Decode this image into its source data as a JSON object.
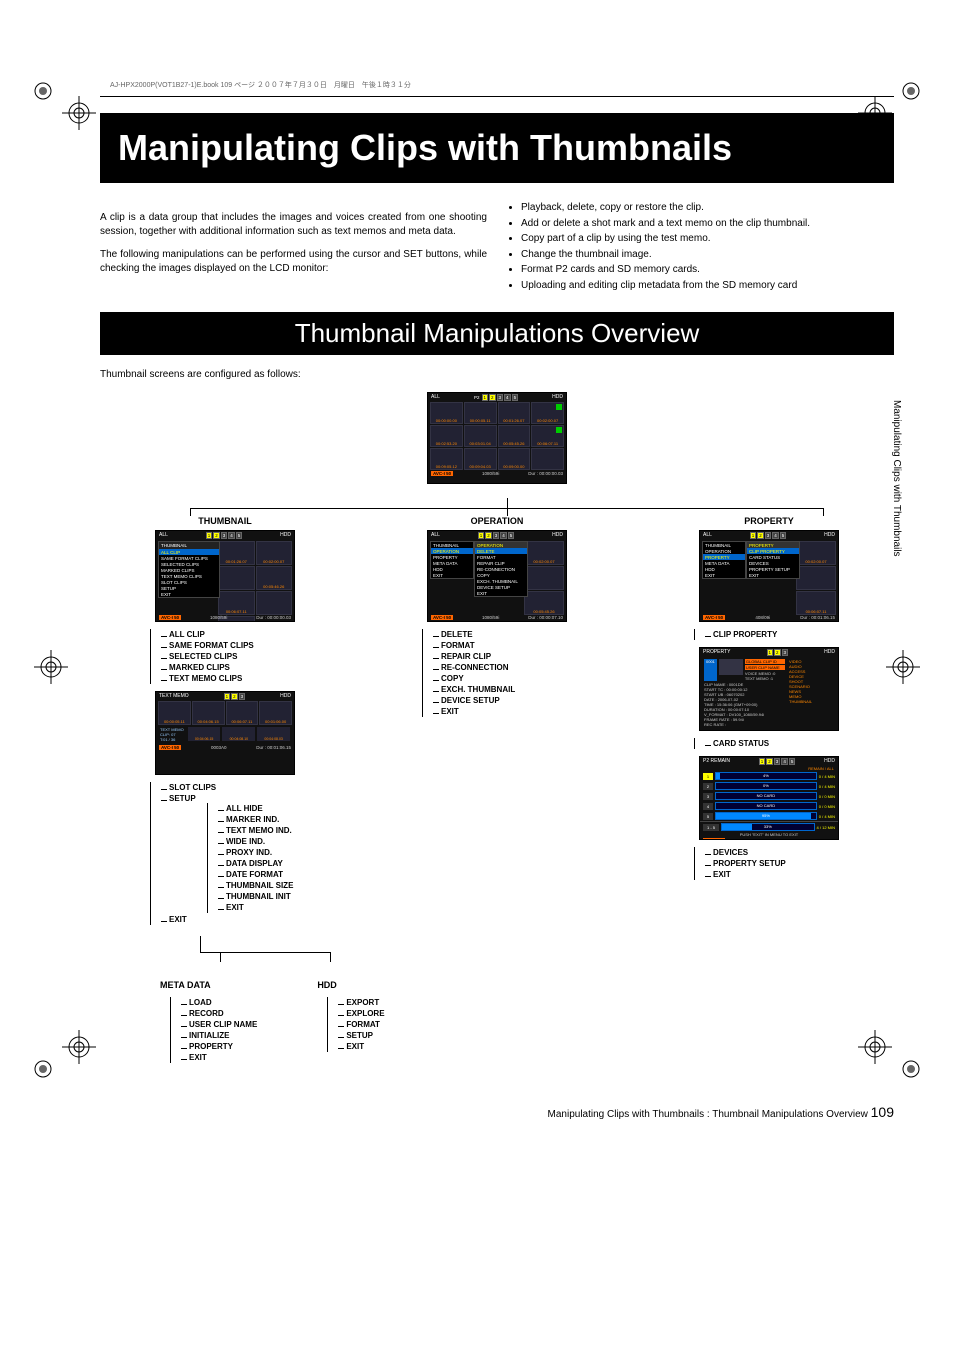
{
  "header_bar": "AJ-HPX2000P(VOT1B27-1)E.book   109 ページ   ２００７年７月３０日　月曜日　午後１時３１分",
  "title": "Manipulating Clips with Thumbnails",
  "intro_col1_p1": "A clip is a data group that includes the images and voices created from one shooting session, together with additional information such as text memos and meta data.",
  "intro_col1_p2": "The following manipulations can be performed using the cursor and SET buttons, while checking the images displayed on the LCD monitor:",
  "intro_col2": [
    "Playback, delete, copy or restore the clip.",
    "Add or delete a shot mark and a text memo on the clip thumbnail.",
    "Copy part of a clip by using the test memo.",
    "Change the thumbnail image.",
    "Format P2 cards and SD memory cards.",
    "Uploading and editing clip metadata from the SD memory card"
  ],
  "subtitle": "Thumbnail Manipulations Overview",
  "subtext": "Thumbnail screens are configured as follows:",
  "top_screen": {
    "all": "ALL",
    "slots": [
      "1",
      "2",
      "3",
      "4",
      "5"
    ],
    "hdd": "HDD",
    "thumbs": [
      "00:00:00.00",
      "00:00:05.11",
      "00:01:26.07",
      "00:02:00.07",
      "00:02:53.20",
      "00:03:01.04",
      "00:05:45.26",
      "00:06:07.11",
      "00:09:05.12",
      "00:09:04.03",
      "00:09:00.00",
      ""
    ],
    "status": {
      "avc": "AVC-I 50",
      "fmt": "1080/59i",
      "dur": "Dur : 00:00:00.03"
    }
  },
  "col_thumbnail": {
    "title": "THUMBNAIL",
    "menu": {
      "header": "THUMBNAIL",
      "items": [
        "ALL CLIP",
        "SAME FORMAT CLIPS",
        "SELECTED CLIPS",
        "MARKED CLIPS",
        "TEXT MEMO CLIPS",
        "SLOT CLIPS",
        "SETUP",
        "EXIT"
      ],
      "right_thumbs": [
        "00:01:26.07",
        "00:02:00.07",
        "",
        "00:05:46.26",
        "00:06:07.11",
        "",
        ""
      ]
    },
    "status": {
      "avc": "AVC-I 50",
      "fmt": "1080/59i",
      "dur": "Dur : 00:00:00.03"
    },
    "tree1": [
      "ALL CLIP",
      "SAME FORMAT CLIPS",
      "SELECTED CLIPS",
      "MARKED CLIPS",
      "TEXT MEMO CLIPS"
    ],
    "textmemo_shot": {
      "title": "TEXT MEMO",
      "thumbs": [
        "",
        "",
        "",
        ""
      ],
      "tc": [
        "00:00:05.11",
        "00:04:06.15",
        "00:06:07.11",
        "00:01:06.00"
      ],
      "lower": "TEXT MEMO\nCLIP: 07\nT:01 / 36",
      "lower_tc": [
        "00:04:06.15",
        "00:04:08.10",
        "00:04:08.03"
      ],
      "status": {
        "avc": "AVC-I 50",
        "fmt": "0003A0",
        "dur": "Dur : 00:01:06.15"
      }
    },
    "tree2_head": [
      "SLOT CLIPS",
      "SETUP",
      "EXIT"
    ],
    "setup_children": [
      "ALL HIDE",
      "MARKER IND.",
      "TEXT MEMO IND.",
      "WIDE IND.",
      "PROXY IND.",
      "DATA DISPLAY",
      "DATE FORMAT",
      "THUMBNAIL SIZE",
      "THUMBNAIL INIT",
      "EXIT"
    ]
  },
  "col_operation": {
    "title": "OPERATION",
    "menu": {
      "left": [
        "THUMBNAIL",
        "OPERATION",
        "PROPERTY",
        "META DATA",
        "HDD",
        "EXIT"
      ],
      "sub_hdr": "OPERATION",
      "sub": [
        "DELETE",
        "FORMAT",
        "REPAIR CLIP",
        "RE-CONNECTION",
        "COPY",
        "EXCH. THUMBNAIL",
        "DEVICE SETUP",
        "EXIT"
      ],
      "right_tc": [
        "00:02:00.07",
        "",
        "00:05:45.26"
      ]
    },
    "status": {
      "avc": "AVC-I 50",
      "fmt": "1080/59i",
      "dur": "Dur : 00:00:07.10"
    },
    "tree": [
      "DELETE",
      "FORMAT",
      "REPAIR CLIP",
      "RE-CONNECTION",
      "COPY",
      "EXCH. THUMBNAIL",
      "DEVICE SETUP",
      "EXIT"
    ]
  },
  "col_property": {
    "title": "PROPERTY",
    "menu": {
      "left": [
        "THUMBNAIL",
        "OPERATION",
        "PROPERTY",
        "META DATA",
        "HDD",
        "EXIT"
      ],
      "sub_hdr": "PROPERTY",
      "sub": [
        "CLIP PROPERTY",
        "CARD STATUS",
        "DEVICES",
        "PROPERTY SETUP",
        "EXIT"
      ],
      "right_tc": [
        "00:02:00.07",
        "",
        "00:06:07.11"
      ]
    },
    "status": {
      "avc": "AVC-I 50",
      "fmt": "408/09i",
      "dur": "Dur : 00:01:06.15"
    },
    "status_thumbs": [
      "00:00:05.11",
      "00:09:04.03",
      "00:09:05.08"
    ],
    "tree1": [
      "CLIP PROPERTY"
    ],
    "clip_prop": {
      "title": "PROPERTY",
      "slot_row": "0001",
      "badges": [
        "GLOBAL CLIP ID",
        "USER CLIP NAME"
      ],
      "right": [
        "VIDEO",
        "AUDIO",
        "ACCESS",
        "DEVICE",
        "SHOOT",
        "SCENARIO",
        "NEWS",
        "MEMO",
        "THUMBNAIL"
      ],
      "voice_memo": "VOICE MEMO  :0",
      "text_memo": "TEXT MEMO  :1",
      "rows": [
        "CLIP NAME   : 0001DE",
        "START TC   : 00:00:00:12",
        "START UB   : 06070202",
        "DATE        : 2006-07-02",
        "TIME        : 15:36:06 (GMT+09:00)",
        "DURATION   : 00:00:07:10",
        "V_FORMAT   : DV100_1080/59.94i",
        "FRAME RATE : 59.94i",
        "REC RATE   :"
      ],
      "footer": "PUSH \"EXIT\" IN MENU TO EXIT",
      "status": {
        "avc": "AVC-I 50"
      }
    },
    "tree2": [
      "CARD STATUS"
    ],
    "card_status": {
      "title": "P2 REMAIN",
      "hdr_right": "REMAIN / ALL",
      "rows": [
        {
          "slot": "1",
          "active": true,
          "pct": "4%",
          "rem": "0 / 4 MIN"
        },
        {
          "slot": "2",
          "active": false,
          "pct": "0%",
          "rem": "0 / 4 MIN"
        },
        {
          "slot": "3",
          "active": false,
          "pct": "NO CARD",
          "rem": "0 / 0 MIN"
        },
        {
          "slot": "4",
          "active": false,
          "pct": "NO CARD",
          "rem": "0 / 0 MIN"
        },
        {
          "slot": "5",
          "active": false,
          "pct": "95%",
          "rem": "0 / 4 MIN"
        }
      ],
      "total": {
        "label": "1 - 5",
        "pct": "33%",
        "rem": "4 / 12 MIN"
      },
      "footer": "PUSH \"EXIT\" IN MENU TO EXIT",
      "status": {
        "avc": "AVC-I 50"
      }
    },
    "tree3": [
      "DEVICES",
      "PROPERTY SETUP",
      "EXIT"
    ]
  },
  "bottom": {
    "meta": {
      "title": "META DATA",
      "items": [
        "LOAD",
        "RECORD",
        "USER CLIP NAME",
        "INITIALIZE",
        "PROPERTY",
        "EXIT"
      ]
    },
    "hdd": {
      "title": "HDD",
      "items": [
        "EXPORT",
        "EXPLORE",
        "FORMAT",
        "SETUP",
        "EXIT"
      ]
    }
  },
  "side_tab": "Manipulating Clips with Thumbnails",
  "footer": {
    "text": "Manipulating Clips with Thumbnails : Thumbnail Manipulations Overview",
    "page": "109"
  }
}
